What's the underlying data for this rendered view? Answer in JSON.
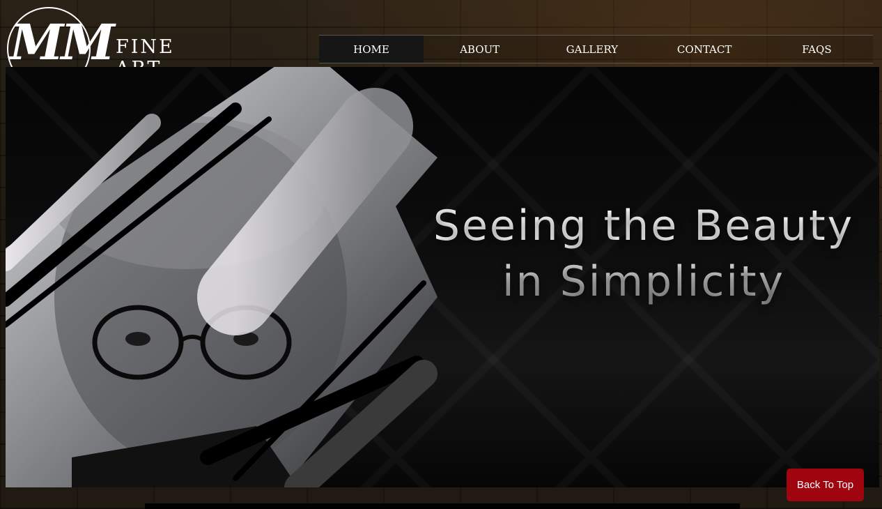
{
  "brand": {
    "monogram": "MM",
    "name": "FINE ART"
  },
  "nav": {
    "items": [
      {
        "label": "HOME",
        "active": true
      },
      {
        "label": "ABOUT"
      },
      {
        "label": "GALLERY"
      },
      {
        "label": "CONTACT"
      },
      {
        "label": "FAQS"
      }
    ]
  },
  "hero": {
    "line1": "Seeing the Beauty",
    "line2": "in Simplicity"
  },
  "back_to_top": "Back To Top",
  "colors": {
    "accent": "#a0050f",
    "nav_active": "#161616"
  }
}
